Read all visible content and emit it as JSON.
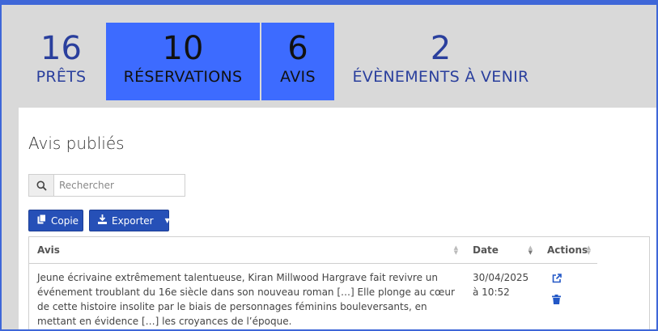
{
  "stats": [
    {
      "number": "16",
      "label": "PRÊTS",
      "active": false
    },
    {
      "number": "10",
      "label": "RÉSERVATIONS",
      "active": true
    },
    {
      "number": "6",
      "label": "AVIS",
      "active": true
    },
    {
      "number": "2",
      "label": "ÉVÈNEMENTS À VENIR",
      "active": false
    }
  ],
  "section": {
    "title": "Avis publiés"
  },
  "search": {
    "placeholder": "Rechercher"
  },
  "buttons": {
    "copy": "Copie",
    "export": "Exporter"
  },
  "table": {
    "columns": [
      "Avis",
      "Date",
      "Actions"
    ],
    "rows": [
      {
        "avis": "Jeune écrivaine extrêmement talentueuse, Kiran Millwood Hargrave fait revivre un événement troublant du 16e siècle dans son nouveau roman […] Elle plonge au cœur de cette histoire insolite par le biais de personnages féminins bouleversants, en mettant en évidence […] les croyances de l’époque.",
        "date": "30/04/2025 à 10:52"
      }
    ]
  },
  "colors": {
    "accent": "#3d6bff",
    "button": "#2650b7",
    "stat_text": "#2a3f9d",
    "border": "#3f67d8"
  },
  "icons": {
    "search": "search-icon",
    "copy": "copy-icon",
    "export": "download-icon",
    "open": "external-link-icon",
    "delete": "trash-icon"
  }
}
